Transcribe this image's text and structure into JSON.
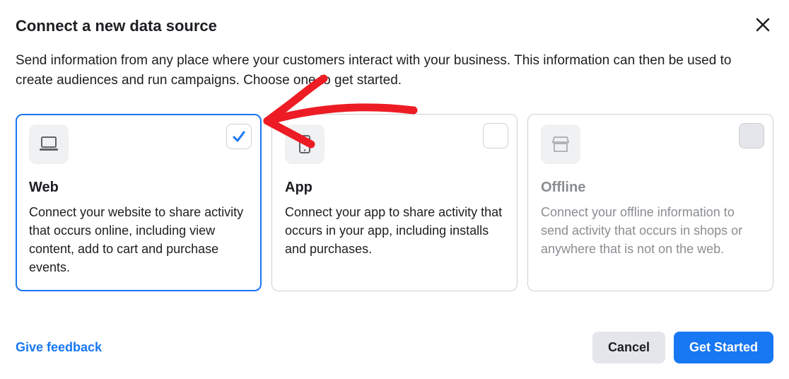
{
  "header": {
    "title": "Connect a new data source"
  },
  "description": "Send information from any place where your customers interact with your business. This information can then be used to create audiences and run campaigns. Choose one to get started.",
  "cards": [
    {
      "icon": "laptop-icon",
      "title": "Web",
      "text": "Connect your website to share activity that occurs online, including view content, add to cart and purchase events.",
      "selected": true,
      "disabled": false
    },
    {
      "icon": "mobile-icon",
      "title": "App",
      "text": "Connect your app to share activity that occurs in your app, including installs and purchases.",
      "selected": false,
      "disabled": false
    },
    {
      "icon": "store-icon",
      "title": "Offline",
      "text": "Connect your offline information to send activity that occurs in shops or anywhere that is not on the web.",
      "selected": false,
      "disabled": true
    }
  ],
  "footer": {
    "feedback_link": "Give feedback",
    "cancel_label": "Cancel",
    "primary_label": "Get Started"
  }
}
